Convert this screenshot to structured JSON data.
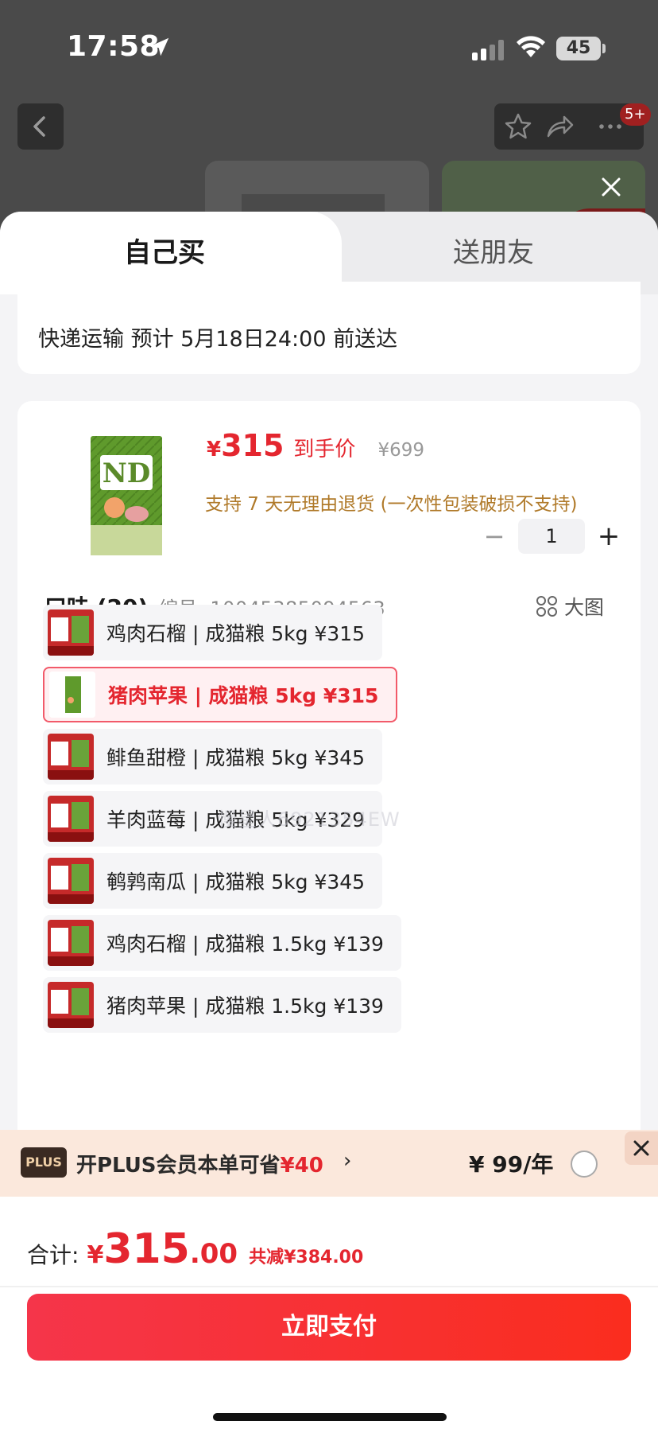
{
  "status_bar": {
    "time": "17:58",
    "battery": "45"
  },
  "nav": {
    "badge": "5+"
  },
  "tabs": {
    "self": "自己买",
    "gift": "送朋友"
  },
  "shipping": {
    "text": "快递运输 预计 5月18日24:00 前送达"
  },
  "product": {
    "currency": "¥",
    "price": "315",
    "price_tag": "到手价",
    "original_price": "¥699",
    "return_note": "支持 7 天无理由退货 (一次性包装破损不支持)",
    "quantity": "1"
  },
  "spec": {
    "title": "口味 (20)",
    "code_label": "编号:",
    "code": "10045385094563",
    "big_view": "大图",
    "watermark": "慢星人6921354EW",
    "options": [
      {
        "label": "鸡肉石榴 | 成猫粮 5kg  ¥315",
        "selected": false
      },
      {
        "label": "猪肉苹果 | 成猫粮 5kg  ¥315",
        "selected": true
      },
      {
        "label": "鲱鱼甜橙 | 成猫粮 5kg  ¥345",
        "selected": false
      },
      {
        "label": "羊肉蓝莓 | 成猫粮 5kg  ¥329",
        "selected": false
      },
      {
        "label": "鹌鹑南瓜 | 成猫粮 5kg  ¥345",
        "selected": false
      },
      {
        "label": "鸡肉石榴 | 成猫粮 1.5kg  ¥139",
        "selected": false
      },
      {
        "label": "猪肉苹果 | 成猫粮 1.5kg  ¥139",
        "selected": false
      }
    ]
  },
  "plus": {
    "logo": "PLUS",
    "text": "开PLUS会员本单可省",
    "saving": "¥40",
    "chevron": "›",
    "price": "¥ 99/年"
  },
  "footer": {
    "total_label": "合计:",
    "currency": "¥",
    "total_int": "315",
    "total_dec": ".00",
    "discount": "共减¥384.00",
    "pay_label": "立即支付"
  },
  "colors": {
    "accent": "#e4262f",
    "selected_border": "#f25a6a",
    "plus_bg": "#fbe8dc"
  }
}
